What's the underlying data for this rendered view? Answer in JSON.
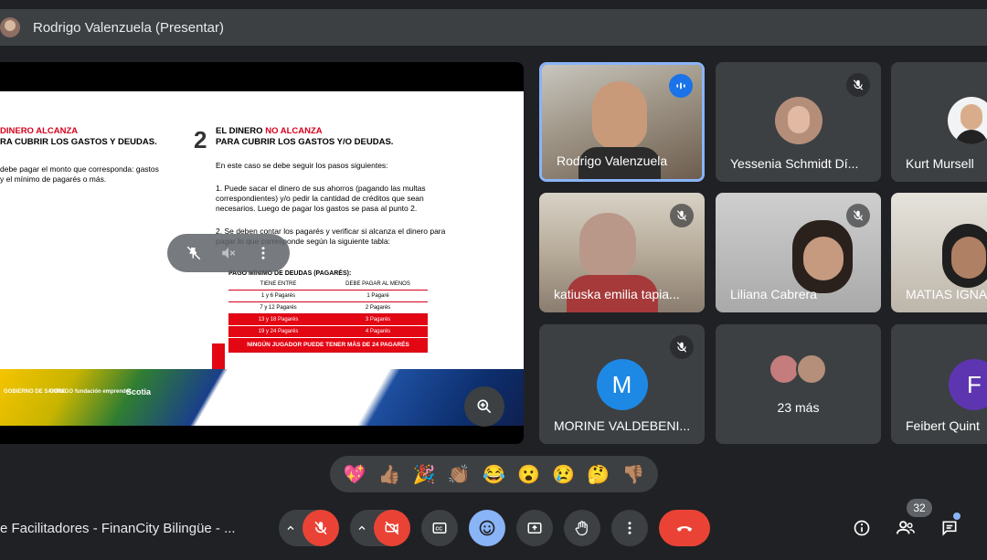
{
  "presenter": {
    "title": "Rodrigo Valenzuela (Presentar)"
  },
  "slide": {
    "left_heading_1": "DINERO ALCANZA",
    "left_heading_2": "RA CUBRIR LOS GASTOS Y DEUDAS.",
    "left_text": "debe pagar el monto que corresponda: gastos y el mínimo de pagarés o más.",
    "number": "2",
    "right_heading_prefix": "EL DINERO ",
    "right_heading_red": "NO ALCANZA",
    "right_heading_2": "PARA CUBRIR LOS GASTOS Y/O DEUDAS.",
    "p1": "En este caso se debe seguir los pasos siguientes:",
    "p2": "1. Puede sacar el dinero de sus ahorros (pagando las multas correspondientes) y/o pedir la cantidad de créditos que sean necesarios. Luego de pagar los gastos se pasa al punto 2.",
    "p3": "2. Se deben contar los pagarés y verificar si alcanza el dinero para pagar lo que corresponde según la siguiente tabla:",
    "table_caption": "PAGO MÍNIMO DE DEUDAS (PAGARÉS):",
    "table_headers": [
      "TIENE ENTRE",
      "DEBE PAGAR AL MENOS"
    ],
    "table_rows": [
      [
        "1 y 6 Pagarés",
        "1 Pagaré"
      ],
      [
        "7 y 12 Pagarés",
        "2 Pagarés"
      ],
      [
        "13 y 18 Pagarés",
        "3 Pagarés"
      ],
      [
        "19 y 24 Pagarés",
        "4 Pagarés"
      ]
    ],
    "table_footer": "NINGÚN JUGADOR PUEDE TENER MÁS DE 24 PAGARÉS",
    "footer_logos": [
      "GOBIERNO DE SANTIAGO",
      "CORE",
      "fundación emprender",
      "Scotia"
    ]
  },
  "participants": [
    {
      "name": "Rodrigo Valenzuela",
      "speaking": true
    },
    {
      "name": "Yessenia Schmidt Dí...",
      "muted": true
    },
    {
      "name": "Kurt Mursell"
    },
    {
      "name": "katiuska emilia tapia...",
      "muted": true
    },
    {
      "name": "Liliana Cabrera",
      "muted": true
    },
    {
      "name": "MATIAS IGNA"
    },
    {
      "name": "MORINE VALDEBENI...",
      "muted": true,
      "initial": "M",
      "color": "#1e88e5"
    },
    {
      "name": "23 más"
    },
    {
      "name": "Feibert Quint",
      "initial": "F",
      "color": "#5e35b1"
    }
  ],
  "reactions": [
    "💖",
    "👍🏽",
    "🎉",
    "👏🏽",
    "😂",
    "😮",
    "😢",
    "🤔",
    "👎🏽"
  ],
  "meeting": {
    "name": "e Facilitadores - FinanCity Bilingüe - ..."
  },
  "people_count": "32",
  "colors": {
    "accent": "#8ab4f8",
    "danger": "#ea4335",
    "surface": "#3c4043",
    "background": "#202124"
  }
}
